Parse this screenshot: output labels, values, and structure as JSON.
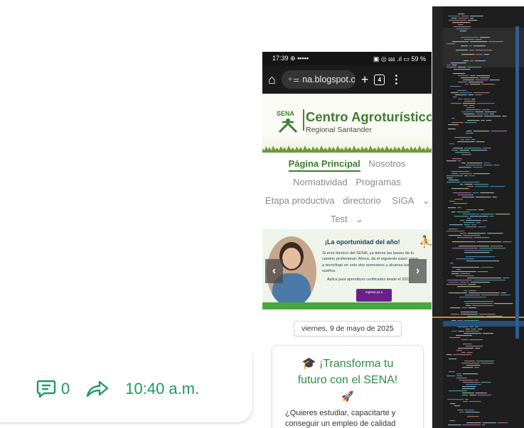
{
  "chat": {
    "comment_count": "0",
    "time": "10:40 a.m."
  },
  "phone": {
    "status": {
      "time": "17:39",
      "battery": "59 %"
    },
    "browser": {
      "url": "na.blogspot.com",
      "tab_count": "4"
    },
    "site": {
      "title": "Centro Agroturístico",
      "subtitle": "Regional Santander",
      "logo_text": "SENA"
    },
    "nav": {
      "items": [
        "Página Principal",
        "Nosotros",
        "Normatividad",
        "Programas",
        "Etapa productiva",
        "directorio",
        "SIGA",
        "Test"
      ]
    },
    "banner": {
      "heading": "¡La oportunidad del año!",
      "text": "Si eres técnico del SENA, ya tienes las bases de tu camino profesional. Ahora, da el siguiente paso: pasa a tecnólogo en solo dos semestres y alcanza tus sueños.",
      "note": "Aplica para aprendices certificados desde el 2022.",
      "button": "Ingresa ya a"
    },
    "date": "viernes, 9 de mayo de 2025",
    "post": {
      "title_line1": "🎓 ¡Transforma tu",
      "title_line2": "futuro con el SENA!",
      "icon": "rocket-icon",
      "body": "¿Quieres estudiar, capacitarte y conseguir un empleo de calidad"
    }
  },
  "snippets": {
    "a": "sh",
    "b": "e=",
    "c": "AV"
  },
  "colors": {
    "accent_green": "#1a9c5c",
    "sena_green": "#3c7d2f"
  }
}
